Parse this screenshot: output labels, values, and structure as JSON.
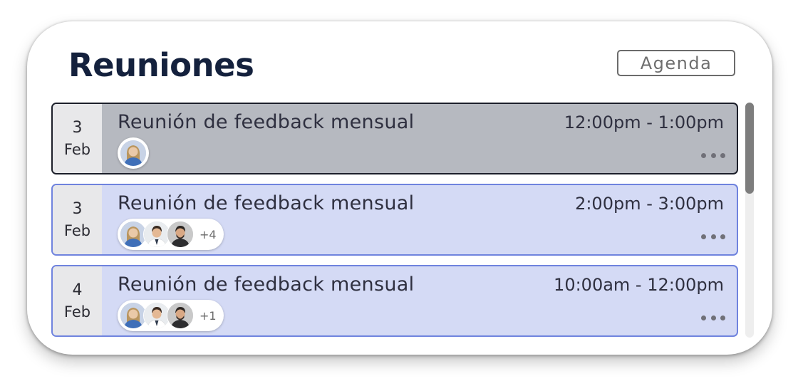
{
  "header": {
    "title": "Reuniones",
    "agenda_label": "Agenda"
  },
  "meetings": [
    {
      "day": "3",
      "month": "Feb",
      "title": "Reunión de feedback mensual",
      "time": "12:00pm - 1:00pm",
      "participants": [
        "avatar-woman-blue"
      ],
      "extra_count": "",
      "selected": true
    },
    {
      "day": "3",
      "month": "Feb",
      "title": "Reunión de feedback mensual",
      "time": "2:00pm - 3:00pm",
      "participants": [
        "avatar-woman-blue",
        "avatar-man-white-shirt",
        "avatar-man-beard"
      ],
      "extra_count": "+4",
      "selected": false
    },
    {
      "day": "4",
      "month": "Feb",
      "title": "Reunión de feedback mensual",
      "time": "10:00am - 12:00pm",
      "participants": [
        "avatar-woman-blue",
        "avatar-man-white-shirt",
        "avatar-man-beard"
      ],
      "extra_count": "+1",
      "selected": false
    }
  ],
  "icons": {
    "more": "more-horizontal-icon"
  },
  "colors": {
    "title": "#14213d",
    "selected_bg": "#b6b9c0",
    "selected_border": "#1c1f2a",
    "item_bg": "#d4daf5",
    "item_border": "#6f83de",
    "scroll_thumb": "#7d7d7d"
  }
}
